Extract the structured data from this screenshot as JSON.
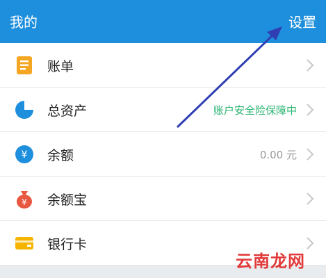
{
  "header": {
    "title": "我的",
    "settings": "设置",
    "bg_color": "#1E8FDC"
  },
  "list": [
    {
      "label": "账单",
      "value": "",
      "icon": "bill-icon",
      "icon_color": "#F5A623"
    },
    {
      "label": "总资产",
      "value": "账户安全险保障中",
      "icon": "pie-chart-icon",
      "icon_color": "#1E8FDC"
    },
    {
      "label": "余额",
      "value": "0.00 元",
      "icon": "yuan-circle-icon",
      "icon_color": "#1E8FDC"
    },
    {
      "label": "余额宝",
      "value": "",
      "icon": "money-bag-icon",
      "icon_color": "#E8573F"
    },
    {
      "label": "银行卡",
      "value": "",
      "icon": "bank-card-icon",
      "icon_color": "#F5B400"
    }
  ],
  "watermark": "云南龙网",
  "colors": {
    "accent": "#1E8FDC",
    "safe_green": "#2bb673",
    "arrow": "#2F3FB3"
  }
}
